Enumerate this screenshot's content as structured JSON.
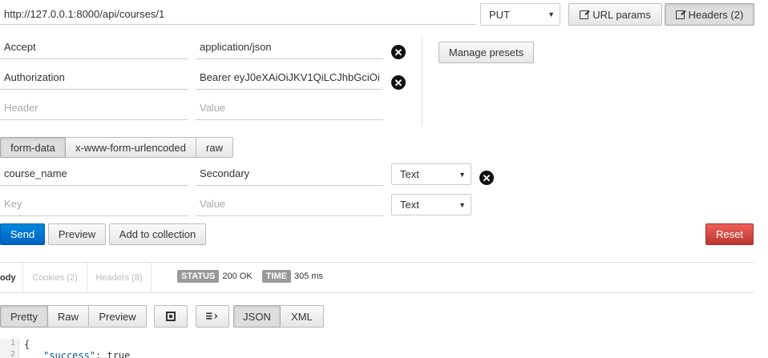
{
  "request": {
    "url": "http://127.0.0.1:8000/api/courses/1",
    "method": "PUT",
    "url_params_label": "URL params",
    "headers_label": "Headers (2)"
  },
  "headers": {
    "rows": [
      {
        "key": "Accept",
        "value": "application/json"
      },
      {
        "key": "Authorization",
        "value": "Bearer eyJ0eXAiOiJKV1QiLCJhbGciOi"
      }
    ],
    "key_placeholder": "Header",
    "value_placeholder": "Value",
    "manage_presets_label": "Manage presets"
  },
  "body_tabs": [
    "form-data",
    "x-www-form-urlencoded",
    "raw"
  ],
  "form": {
    "rows": [
      {
        "key": "course_name",
        "value": "Secondary",
        "type": "Text"
      }
    ],
    "key_placeholder": "Key",
    "value_placeholder": "Value",
    "new_type": "Text"
  },
  "actions": {
    "send": "Send",
    "preview": "Preview",
    "add_to_collection": "Add to collection",
    "reset": "Reset"
  },
  "response": {
    "tabs": [
      "ody",
      "Cookies (2)",
      "Headers (8)"
    ],
    "status_label": "STATUS",
    "status_value": "200 OK",
    "time_label": "TIME",
    "time_value": "305 ms",
    "view_tabs": [
      "Pretty",
      "Raw",
      "Preview"
    ],
    "format_tabs": [
      "JSON",
      "XML"
    ],
    "code": {
      "line1_no": "1",
      "line1": "{",
      "line2_no": "2",
      "line2_key": "\"success\"",
      "line2_val": ": true"
    }
  },
  "colors": {
    "send": "#0070d2",
    "reset": "#d9534f"
  }
}
